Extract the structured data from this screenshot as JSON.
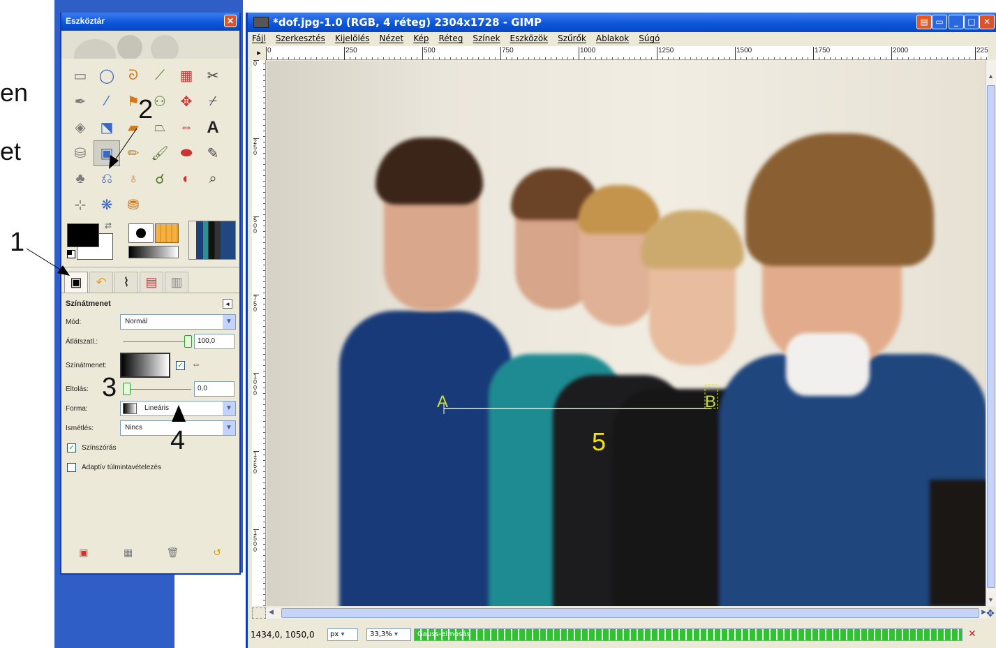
{
  "side_text": [
    "en",
    "et"
  ],
  "annotations": [
    "1",
    "2",
    "3",
    "4",
    "5"
  ],
  "toolbox": {
    "title": "Eszköztár",
    "tools": [
      {
        "name": "rect-select-icon",
        "glyph": "▭"
      },
      {
        "name": "ellipse-select-icon",
        "glyph": "◯"
      },
      {
        "name": "lasso-icon",
        "glyph": "ᘐ"
      },
      {
        "name": "magic-wand-icon",
        "glyph": "⟋"
      },
      {
        "name": "select-by-color-icon",
        "glyph": "▦"
      },
      {
        "name": "scissors-icon",
        "glyph": "✂"
      },
      {
        "name": "paths-icon",
        "glyph": "✒"
      },
      {
        "name": "color-picker-icon",
        "glyph": "⁄"
      },
      {
        "name": "measure-icon",
        "glyph": "⚑"
      },
      {
        "name": "align-icon",
        "glyph": "⚇"
      },
      {
        "name": "move-icon",
        "glyph": "✥"
      },
      {
        "name": "crop-icon",
        "glyph": "⌿"
      },
      {
        "name": "rotate-icon",
        "glyph": "◈"
      },
      {
        "name": "scale-icon",
        "glyph": "⬔"
      },
      {
        "name": "shear-icon",
        "glyph": "▰"
      },
      {
        "name": "perspective-icon",
        "glyph": "⏢"
      },
      {
        "name": "flip-icon",
        "glyph": "⇔"
      },
      {
        "name": "text-icon",
        "glyph": "A"
      },
      {
        "name": "bucket-fill-icon",
        "glyph": "⛁"
      },
      {
        "name": "blend-icon",
        "glyph": "▣"
      },
      {
        "name": "pencil-icon",
        "glyph": "✏"
      },
      {
        "name": "paintbrush-icon",
        "glyph": "🖌"
      },
      {
        "name": "eraser-icon",
        "glyph": "⬬"
      },
      {
        "name": "airbrush-icon",
        "glyph": "✎"
      },
      {
        "name": "ink-icon",
        "glyph": "♣"
      },
      {
        "name": "clone-icon",
        "glyph": "⎌"
      },
      {
        "name": "heal-icon",
        "glyph": "♁"
      },
      {
        "name": "smudge-icon",
        "glyph": "☌"
      },
      {
        "name": "dodge-burn-icon",
        "glyph": "◐"
      },
      {
        "name": "zoom-icon",
        "glyph": "⌕"
      },
      {
        "name": "transform-icon",
        "glyph": "⊹"
      },
      {
        "name": "convolve-icon",
        "glyph": "❋"
      },
      {
        "name": "color-tool-icon",
        "glyph": "⛃"
      }
    ],
    "colors": {
      "foreground": "#000000",
      "background": "#ffffff"
    }
  },
  "tool_options": {
    "title": "Színátmenet",
    "mode_label": "Mód:",
    "mode_value": "Normál",
    "opacity_label": "Átlátszatl.:",
    "opacity_value": "100,0",
    "opacity_level": 1.0,
    "gradient_label": "Színátmenet:",
    "offset_label": "Eltolás:",
    "offset_value": "0,0",
    "offset_level": 0.0,
    "shape_label": "Forma:",
    "shape_value": "Lineáris",
    "repeat_label": "Ismétlés:",
    "repeat_value": "Nincs",
    "dither_label": "Színszórás",
    "dither_checked": true,
    "adaptive_label": "Adaptív túlmintavételezés",
    "adaptive_checked": false
  },
  "image_window": {
    "title": "*dof.jpg-1.0 (RGB, 4 réteg) 2304x1728 - GIMP",
    "menu": [
      "Fájl",
      "Szerkesztés",
      "Kijelölés",
      "Nézet",
      "Kép",
      "Réteg",
      "Színek",
      "Eszközök",
      "Szűrők",
      "Ablakok",
      "Súgó"
    ],
    "ruler_h": [
      "0",
      "250",
      "500",
      "750",
      "1000",
      "1250",
      "1500",
      "1750",
      "2000",
      "225"
    ],
    "ruler_v": [
      "0",
      "250",
      "500",
      "750",
      "1000",
      "1250",
      "1500"
    ],
    "gradient_line": {
      "start_label": "A",
      "end_label": "B"
    },
    "status": {
      "coords": "1434,0, 1050,0",
      "unit": "px",
      "zoom": "33,3%",
      "progress_text": "Gauss-elmosás",
      "progress": 1.0
    }
  }
}
